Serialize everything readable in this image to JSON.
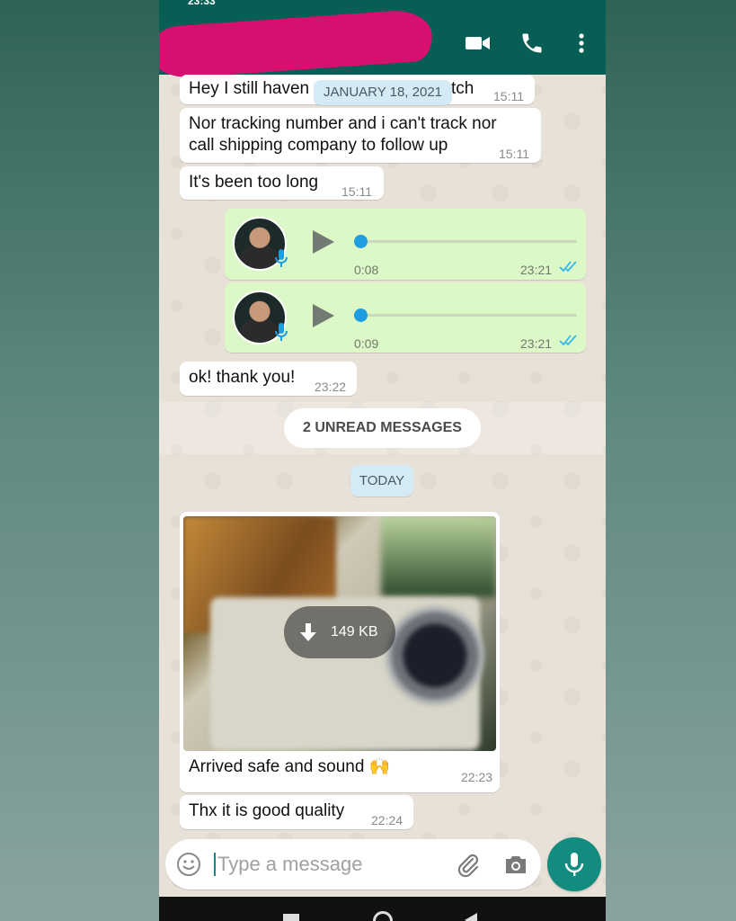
{
  "status": {
    "time": "23:33",
    "icons": "◎ ⊙ ⊙ ◻ ◻",
    "right_icons": "▮▮▮ ▮▮▮ ▭"
  },
  "header": {
    "contact_name": "",
    "video_icon": "video-camera-icon",
    "call_icon": "phone-icon",
    "menu_icon": "more-vertical-icon"
  },
  "messages": {
    "m1": {
      "text": "Hey I still haven",
      "text_end": "tch",
      "time": "15:11"
    },
    "date_pill": "JANUARY 18, 2021",
    "m2": {
      "line1": "Nor tracking number and i can't track nor",
      "line2": "call shipping company to follow up",
      "time": "15:11"
    },
    "m3": {
      "text": "It's been too long",
      "time": "15:11"
    },
    "v1": {
      "duration": "0:08",
      "time": "23:21"
    },
    "v2": {
      "duration": "0:09",
      "time": "23:21"
    },
    "m4": {
      "text": "ok! thank you!",
      "time": "23:22"
    },
    "unread_label": "2 UNREAD MESSAGES",
    "today_pill": "TODAY",
    "photo": {
      "download_size": "149 KB"
    },
    "m5": {
      "text": "Arrived safe and sound 🙌",
      "time": "22:23"
    },
    "m6": {
      "text": "Thx it is good quality",
      "time": "22:24"
    }
  },
  "composer": {
    "placeholder": "Type a message",
    "emoji_icon": "emoji-icon",
    "attach_icon": "paperclip-icon",
    "camera_icon": "camera-icon",
    "mic_icon": "microphone-icon"
  },
  "colors": {
    "header": "#075e54",
    "outgoing": "#dcf8c6",
    "accent": "#128c7e",
    "tick": "#34b7f1",
    "redaction": "#d6106f"
  }
}
